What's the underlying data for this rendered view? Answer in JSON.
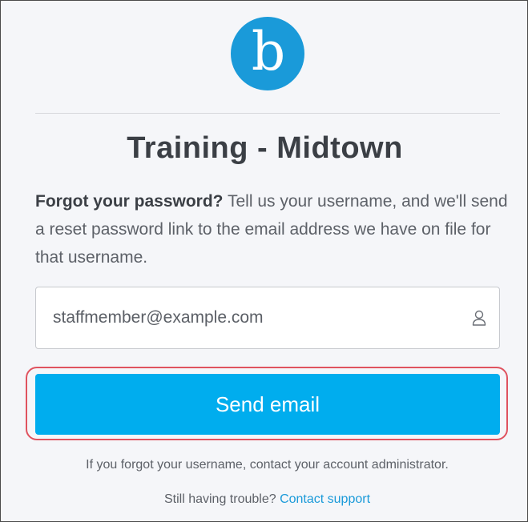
{
  "logo": {
    "letter": "b",
    "color": "#1a9ad9"
  },
  "title": "Training - Midtown",
  "description": {
    "bold": "Forgot your password?",
    "text": " Tell us your username, and we'll send a reset password link to the email address we have on file for that username."
  },
  "username_field": {
    "value": "",
    "placeholder": "staffmember@example.com",
    "icon": "user-icon"
  },
  "send_button": {
    "label": "Send email",
    "color": "#00adee"
  },
  "help": {
    "forgot_username": "If you forgot your username, contact your account administrator.",
    "trouble_prefix": "Still having trouble? ",
    "contact_link": "Contact support",
    "link_color": "#1a9ad9"
  },
  "highlight_color": "#e0535f"
}
